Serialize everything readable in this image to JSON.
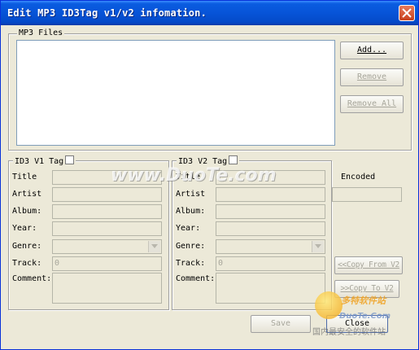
{
  "window": {
    "title": "Edit MP3 ID3Tag v1/v2 infomation."
  },
  "mp3_files": {
    "label": "MP3 Files",
    "add": "Add...",
    "remove": "Remove",
    "remove_all": "Remove All"
  },
  "v1": {
    "label": "ID3 V1 Tag",
    "fields": {
      "title": "Title",
      "artist": "Artist",
      "album": "Album:",
      "year": "Year:",
      "genre": "Genre:",
      "track": "Track:",
      "comment": "Comment:"
    },
    "track_value": "0"
  },
  "v2": {
    "label": "ID3 V2 Tag",
    "fields": {
      "title": "Title",
      "artist": "Artist",
      "album": "Album:",
      "year": "Year:",
      "genre": "Genre:",
      "track": "Track:",
      "comment": "Comment:"
    },
    "track_value": "0"
  },
  "encoded": {
    "label": "Encoded"
  },
  "buttons": {
    "copy_from_v2": "<<Copy From V2",
    "copy_to_v2": ">>Copy To V2",
    "save": "Save",
    "close": "Close"
  },
  "watermarks": {
    "duote": "www.DuoTe.com",
    "corner_brand": "多特软件站",
    "corner_url": "DuoTe.Com",
    "corner_slogan": "国内最安全的软件站"
  },
  "colors": {
    "titlebar": "#0754d8",
    "face": "#ece9d8",
    "close": "#d4552f"
  }
}
